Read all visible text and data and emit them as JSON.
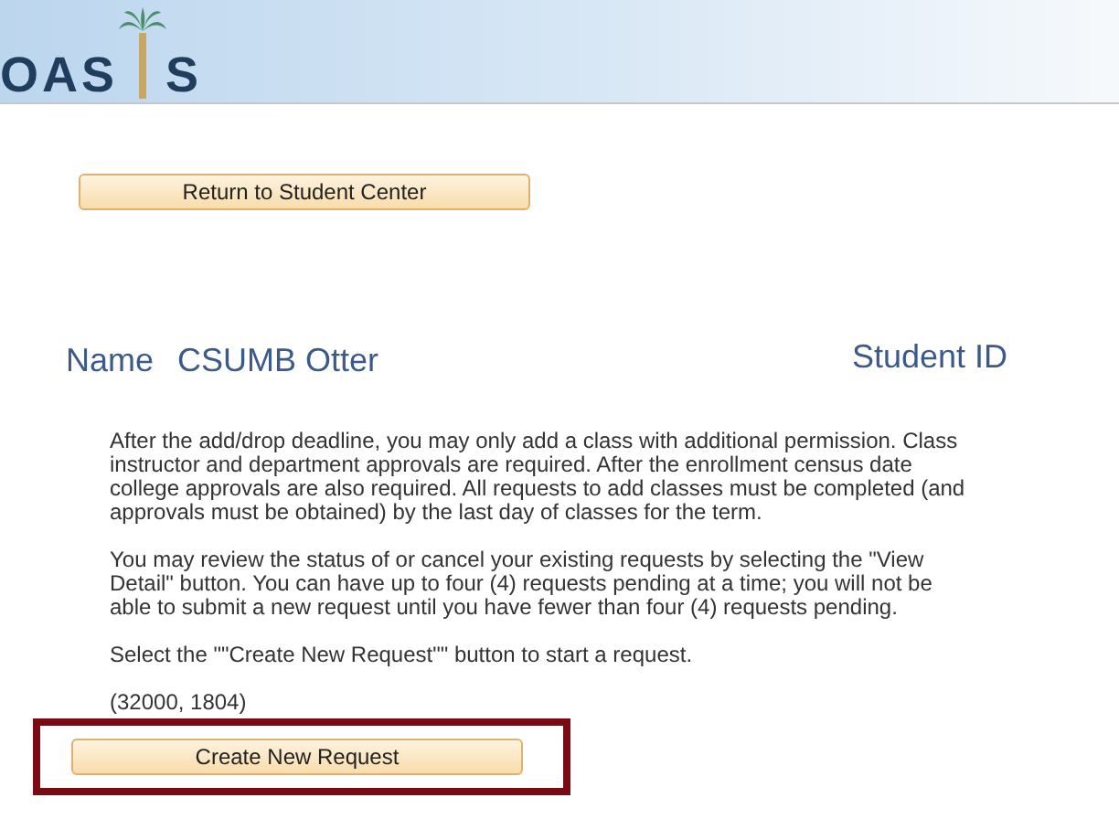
{
  "logo": {
    "left": "OAS",
    "right": "S"
  },
  "return_button": "Return to Student Center",
  "name_label": "Name",
  "name_value": "CSUMB Otter",
  "student_id_label": "Student ID",
  "paragraphs": [
    "After the add/drop deadline, you may only add a class with additional permission. Class instructor and department approvals are required. After the enrollment census date college approvals are also required. All requests to add classes must be completed (and approvals must be obtained) by the last day of classes for the term.",
    "You may review the status of or cancel your existing requests by selecting the \"View Detail\" button. You can have up to four (4) requests pending at a time; you will not be able to submit a new request until you have fewer than four (4) requests pending.",
    "Select the \"\"Create New Request\"\" button to start a request.",
    "(32000, 1804)"
  ],
  "create_button": {
    "label": "Create New Request",
    "highlighted": true
  }
}
